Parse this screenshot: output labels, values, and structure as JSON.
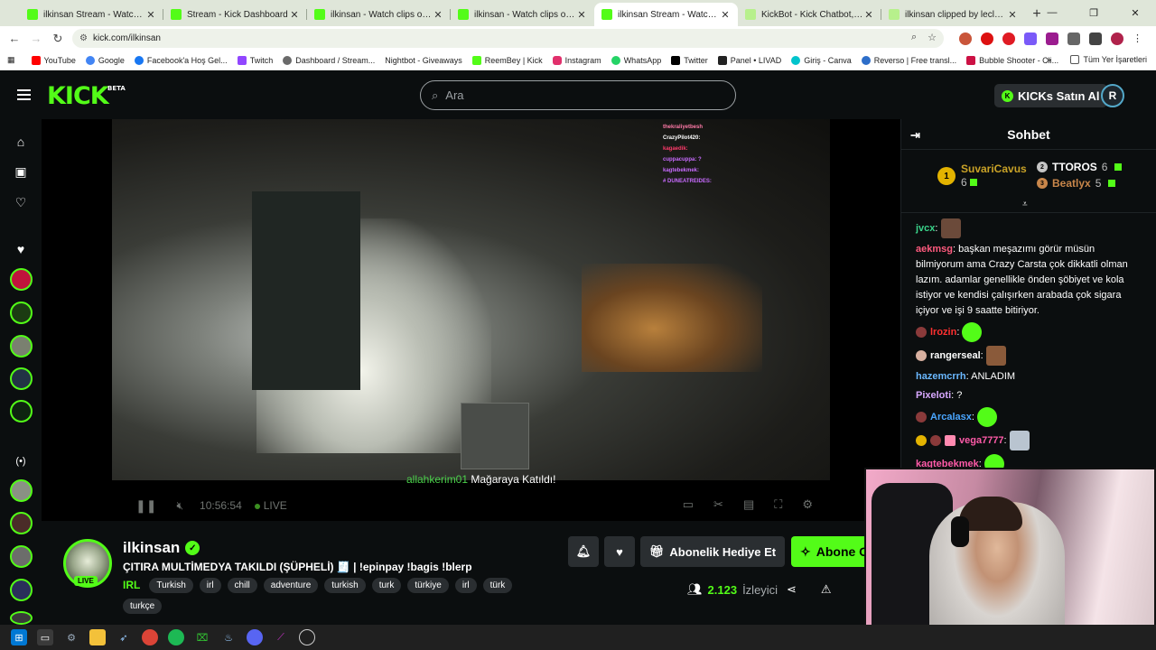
{
  "browser": {
    "tabs": [
      {
        "label": "ilkinsan Stream - Watch Live on Kick",
        "active": false
      },
      {
        "label": "Stream - Kick Dashboard",
        "active": false
      },
      {
        "label": "ilkinsan - Watch clips on Kick",
        "active": false
      },
      {
        "label": "ilkinsan - Watch clips on Kick",
        "active": false
      },
      {
        "label": "ilkinsan Stream - Watch Live on Kick",
        "active": true
      },
      {
        "label": "KickBot - Kick Chatbot, Alerts, T",
        "active": false
      },
      {
        "label": "ilkinsan clipped by leclercurry",
        "active": false
      }
    ],
    "url": "kick.com/ilkinsan",
    "bookmarks": [
      "YouTube",
      "Google",
      "Facebook'a Hoş Gel...",
      "Twitch",
      "Dashboard / Stream...",
      "Nightbot - Giveaways",
      "ReemBey | Kick",
      "Instagram",
      "WhatsApp",
      "Twitter",
      "Panel • LIVAD",
      "Giriş - Canva",
      "Reverso | Free transl...",
      "Bubble Shooter - Cli..."
    ],
    "bookmarks_more": "»",
    "bookmarks_all": "Tüm Yer İşaretleri"
  },
  "kick": {
    "logo": "KICK",
    "logo_badge": "BETA",
    "search_placeholder": "Ara",
    "buy_kicks": "KICKs Satın Al",
    "user_initial": "R"
  },
  "video": {
    "overlay_chat": [
      {
        "text": "thekraliyetbesh",
        "color": "#ff7aa8"
      },
      {
        "text": "CrazyPilot420:",
        "color": "#ffffff"
      },
      {
        "text": "kagaedik:",
        "color": "#ff3a6b"
      },
      {
        "text": "cuppacuppa: ?",
        "color": "#c86bff"
      },
      {
        "text": "kagtebekmek:",
        "color": "#c86bff"
      },
      {
        "text": "# DUNEATREIDES:",
        "color": "#c86bff"
      }
    ],
    "join_user": "allahkerim01",
    "join_text": "Mağaraya Katıldı!",
    "time": "10:56:54",
    "live_label": "LIVE"
  },
  "stream": {
    "name": "ilkinsan",
    "live_badge": "LIVE",
    "title": "ÇITIRA MULTİMEDYA TAKILDI (ŞÜPHELİ) 🧾 | !epinpay !bagis !blerp",
    "category": "IRL",
    "tags": [
      "Turkish",
      "irl",
      "chill",
      "adventure",
      "turkish",
      "turk",
      "türkiye",
      "irl",
      "türk",
      "turkçe"
    ],
    "gift_sub_label": "Abonelik Hediye Et",
    "subscribe_label": "Abone Ol",
    "viewers_count": "2.123",
    "viewers_label": "İzleyici"
  },
  "chat": {
    "title": "Sohbet",
    "leaderboard": [
      {
        "rank": "1",
        "name": "SuvariCavus",
        "count": "6"
      },
      {
        "rank": "2",
        "name": "TTOROS",
        "count": "6"
      },
      {
        "rank": "3",
        "name": "Beatlyx",
        "count": "5"
      }
    ],
    "messages": [
      {
        "user": "jvcx",
        "color": "#3ad38a",
        "text": "",
        "emote": "#6b4a3a"
      },
      {
        "user": "aekmsg",
        "color": "#ff5a7e",
        "text": "başkan meşazımı görür müsün bilmiyorum ama Crazy Carsta çok dikkatli olman lazım. adamlar genellikle önden şöbiyet ve kola istiyor ve kendisi çalışırken arabada çok sigara içiyor ve işi 9 saatte bitiriyor.",
        "emote": ""
      },
      {
        "user": "lrozin",
        "color": "#ff3030",
        "text": "",
        "emote": "#53fc18"
      },
      {
        "user": "rangerseal",
        "color": "#ffffff",
        "text": "",
        "emote": "#8a5a3a"
      },
      {
        "user": "hazemcrrh",
        "color": "#6ab8ff",
        "text": "ANLADIM",
        "emote": ""
      },
      {
        "user": "Pixeloti",
        "color": "#d8a8ff",
        "text": "?",
        "emote": ""
      },
      {
        "user": "Arcalasx",
        "color": "#4aa6ff",
        "text": "",
        "emote": "#53fc18"
      },
      {
        "user": "vega7777",
        "color": "#ff5aa8",
        "text": "",
        "emote": "#b9c4d0"
      },
      {
        "user": "kagtebekmek",
        "color": "#ff5aa8",
        "text": "",
        "emote": "#53fc18"
      }
    ]
  },
  "taskbar": {
    "items": [
      "windows-icon",
      "taskview-icon",
      "settings-icon",
      "explorer-icon",
      "steam-icon",
      "chrome-icon",
      "spotify-icon",
      "xbox-icon",
      "steam2-icon",
      "discord-icon",
      "app-icon",
      "obs-icon"
    ]
  },
  "colors": {
    "kick_green": "#53fc18",
    "background": "#0b0e0f",
    "chip": "#2a2e31"
  }
}
